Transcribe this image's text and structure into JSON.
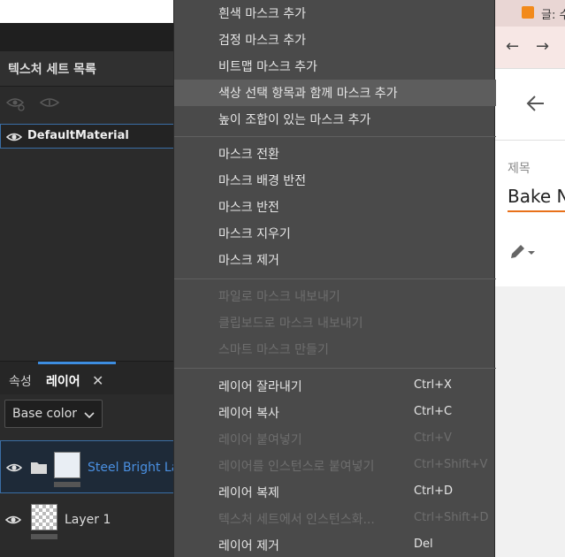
{
  "texture_sets": {
    "title": "텍스처 세트 목록",
    "items": [
      {
        "label": "DefaultMaterial"
      }
    ]
  },
  "tabs": {
    "properties_label": "속성",
    "layers_label": "레이어",
    "close_glyph": "✕"
  },
  "channel_select": {
    "value": "Base color"
  },
  "layers": [
    {
      "name": "Steel Bright Lay",
      "selected": true
    },
    {
      "name": "Layer 1",
      "selected": false
    }
  ],
  "context_menu": {
    "groups": [
      [
        {
          "label": "흰색 마스크 추가",
          "shortcut": "",
          "enabled": true
        },
        {
          "label": "검정 마스크 추가",
          "shortcut": "",
          "enabled": true
        },
        {
          "label": "비트맵 마스크 추가",
          "shortcut": "",
          "enabled": true
        },
        {
          "label": "색상 선택 항목과 함께 마스크 추가",
          "shortcut": "",
          "enabled": true,
          "highlighted": true
        },
        {
          "label": "높이 조합이 있는 마스크 추가",
          "shortcut": "",
          "enabled": true
        }
      ],
      [
        {
          "label": "마스크 전환",
          "shortcut": "",
          "enabled": true
        },
        {
          "label": "마스크 배경 반전",
          "shortcut": "",
          "enabled": true
        },
        {
          "label": "마스크 반전",
          "shortcut": "",
          "enabled": true
        },
        {
          "label": "마스크 지우기",
          "shortcut": "",
          "enabled": true
        },
        {
          "label": "마스크 제거",
          "shortcut": "",
          "enabled": true
        }
      ],
      [
        {
          "label": "파일로 마스크 내보내기",
          "shortcut": "",
          "enabled": false
        },
        {
          "label": "클립보드로 마스크 내보내기",
          "shortcut": "",
          "enabled": false
        },
        {
          "label": "스마트 마스크 만들기",
          "shortcut": "",
          "enabled": false
        }
      ],
      [
        {
          "label": "레이어 잘라내기",
          "shortcut": "Ctrl+X",
          "enabled": true
        },
        {
          "label": "레이어 복사",
          "shortcut": "Ctrl+C",
          "enabled": true
        },
        {
          "label": "레이어 붙여넣기",
          "shortcut": "Ctrl+V",
          "enabled": false
        },
        {
          "label": "레이어를 인스턴스로 붙여넣기",
          "shortcut": "Ctrl+Shift+V",
          "enabled": false
        },
        {
          "label": "레이어 복제",
          "shortcut": "Ctrl+D",
          "enabled": true
        },
        {
          "label": "텍스처 세트에서 인스턴스화...",
          "shortcut": "Ctrl+Shift+D",
          "enabled": false
        },
        {
          "label": "레이어 제거",
          "shortcut": "Del",
          "enabled": true
        }
      ]
    ]
  },
  "browser": {
    "tab_title": "글: 수",
    "back_glyph": "←",
    "forward_glyph": "→",
    "field_label": "제목",
    "post_title": "Bake N"
  },
  "colors": {
    "accent_blue": "#3d8de0",
    "menu_bg": "#4a4a4a",
    "menu_highlight": "#5d5d5d",
    "underline_orange": "#e8711a",
    "favicon_orange": "#f28a1b"
  }
}
